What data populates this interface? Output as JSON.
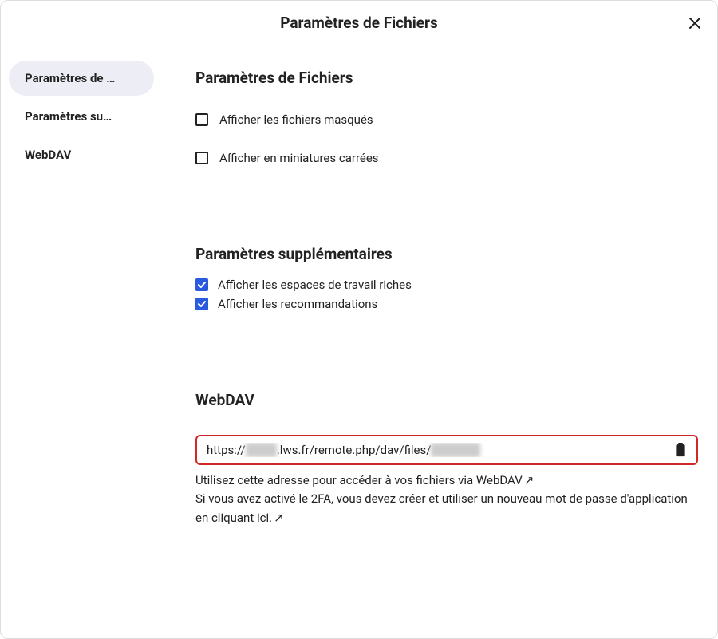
{
  "header": {
    "title": "Paramètres de Fichiers"
  },
  "sidebar": {
    "items": [
      {
        "label": "Paramètres de …",
        "active": true
      },
      {
        "label": "Paramètres su…",
        "active": false
      },
      {
        "label": "WebDAV",
        "active": false
      }
    ]
  },
  "sections": {
    "files": {
      "title": "Paramètres de Fichiers",
      "opts": {
        "hidden": {
          "label": "Afficher les fichiers masqués",
          "checked": false
        },
        "square": {
          "label": "Afficher en miniatures carrées",
          "checked": false
        }
      }
    },
    "extra": {
      "title": "Paramètres supplémentaires",
      "opts": {
        "workspaces": {
          "label": "Afficher les espaces de travail riches",
          "checked": true
        },
        "recs": {
          "label": "Afficher les recommandations",
          "checked": true
        }
      }
    },
    "webdav": {
      "title": "WebDAV",
      "url_parts": {
        "pre": "https://",
        "hidden1": "xxxxx",
        "mid": ".lws.fr/remote.php/dav/files/",
        "hidden2": "xxxxxxxx"
      },
      "help1_text": "Utilisez cette adresse pour accéder à vos fichiers via WebDAV",
      "help2_text": "Si vous avez activé le 2FA, vous devez créer et utiliser un nouveau mot de passe d'application en cliquant ici.",
      "arrow": "↗"
    }
  }
}
